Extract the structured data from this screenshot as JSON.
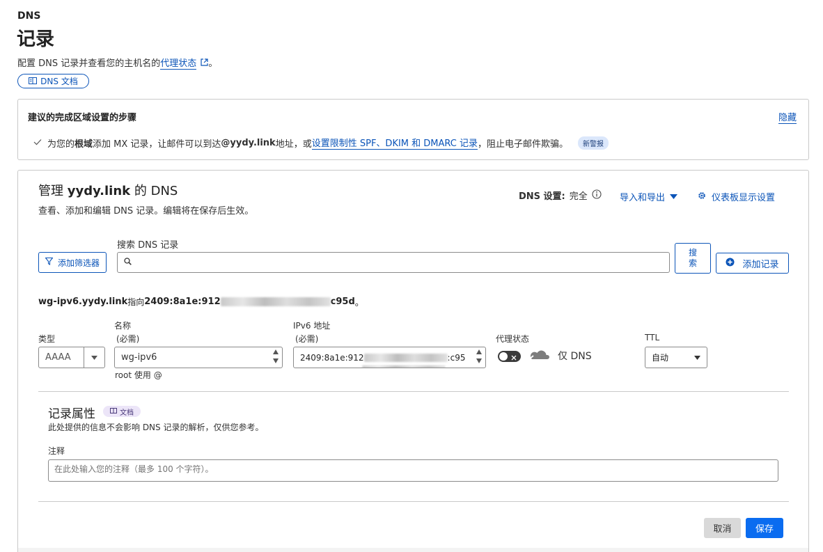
{
  "header": {
    "section": "DNS",
    "title": "记录",
    "description_prefix": "配置 DNS 记录并查看您的主机名的",
    "description_link": "代理状态",
    "description_suffix": "。",
    "docs_button": "DNS 文档"
  },
  "steps": {
    "title": "建议的完成区域设置的步骤",
    "hide_link": "隐藏",
    "item": {
      "t1": "为您的",
      "t2": "根域",
      "t3": "添加 MX 记录，让邮件可以到达 ",
      "t4": "@yydy.link",
      "t5": " 地址，或",
      "link": "设置限制性 SPF、DKIM 和 DMARC 记录",
      "t6": "，阻止电子邮件欺骗。",
      "badge": "新警报"
    }
  },
  "manage": {
    "title_prefix": "管理 ",
    "domain": "yydy.link",
    "title_suffix": " 的 DNS",
    "subtitle": "查看、添加和编辑 DNS 记录。编辑将在保存后生效。",
    "dns_setting_label": "DNS 设置:",
    "dns_setting_value": "完全",
    "import_export": "导入和导出",
    "dashboard_settings": "仪表板显示设置"
  },
  "toolbar": {
    "filter_button": "添加筛选器",
    "search_label": "搜索 DNS 记录",
    "search_placeholder": "",
    "search_button_l1": "搜",
    "search_button_l2": "索",
    "add_record_button": "添加记录"
  },
  "record": {
    "summary_name": "wg-ipv6.yydy.link",
    "summary_points": " 指向 ",
    "summary_ip_start": "2409:8a1e:912",
    "summary_ip_end": "c95d",
    "summary_end": "。",
    "type_label": "类型",
    "type_value": "AAAA",
    "name_label": "名称",
    "name_required": "(必需)",
    "name_value": "wg-ipv6",
    "name_hint": "root 使用 @",
    "ipv6_label": "IPv6 地址",
    "ipv6_required": "(必需)",
    "ipv6_value_start": "2409:8a1e:912",
    "ipv6_value_end": ":c95",
    "proxy_label": "代理状态",
    "proxy_value": "仅 DNS",
    "ttl_label": "TTL",
    "ttl_value": "自动"
  },
  "attributes": {
    "title": "记录属性",
    "docs_badge": "文档",
    "description": "此处提供的信息不会影响 DNS 记录的解析，仅供您参考。",
    "comment_label": "注释",
    "comment_placeholder": "在此处输入您的注释（最多 100 个字符）。"
  },
  "actions": {
    "cancel": "取消",
    "save": "保存"
  },
  "colors": {
    "link": "#0b54b8",
    "primary": "#0a6cf0",
    "badge_bg": "#dbe7fb",
    "cancel_bg": "#d9d9d9"
  }
}
